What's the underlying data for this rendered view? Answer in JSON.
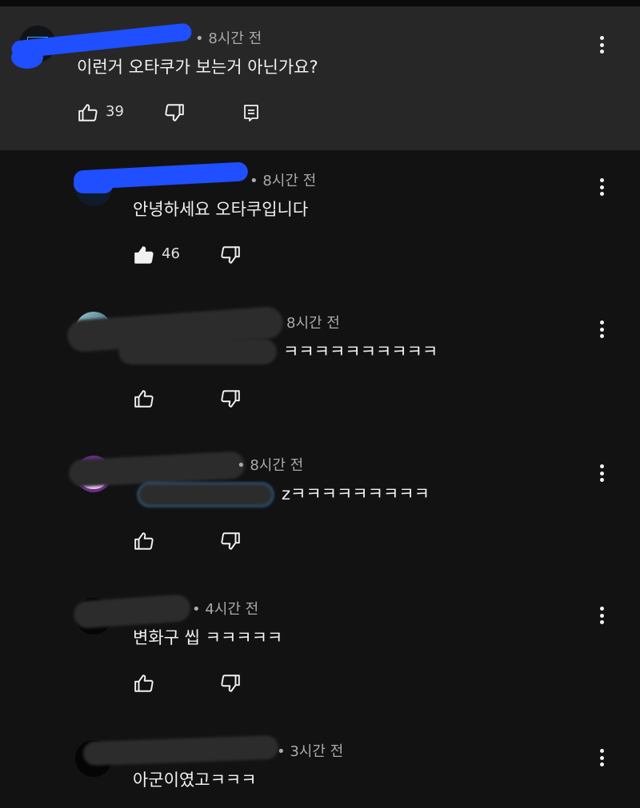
{
  "comments": [
    {
      "time": "• 8시간 전",
      "text": "이런거 오타쿠가 보는거 아닌가요?",
      "likes": "39",
      "like_filled": false,
      "has_reply_button": true
    },
    {
      "time": "• 8시간 전",
      "text": "안녕하세요 오타쿠입니다",
      "likes": "46",
      "like_filled": true
    },
    {
      "time": "8시간 전",
      "text": "ㅋㅋㅋㅋㅋㅋㅋㅋㅋㅋ",
      "likes": "",
      "like_filled": false
    },
    {
      "time": "• 8시간 전",
      "text": "zㅋㅋㅋㅋㅋㅋㅋㅋㅋ",
      "likes": "",
      "like_filled": false
    },
    {
      "time": "• 4시간 전",
      "text": "변화구 씹 ㅋㅋㅋㅋㅋ",
      "likes": "",
      "like_filled": false
    },
    {
      "time": "• 3시간 전",
      "text": "아군이였고ㅋㅋㅋ",
      "likes": "",
      "like_filled": false
    }
  ],
  "icons": {
    "like": "thumbs-up-icon",
    "dislike": "thumbs-down-icon",
    "reply": "reply-icon",
    "more": "more-vert-icon"
  },
  "colors": {
    "background": "#121212",
    "highlight": "#272727",
    "mention": "#3ea6ff",
    "redaction_blue": "#1f4fff"
  }
}
